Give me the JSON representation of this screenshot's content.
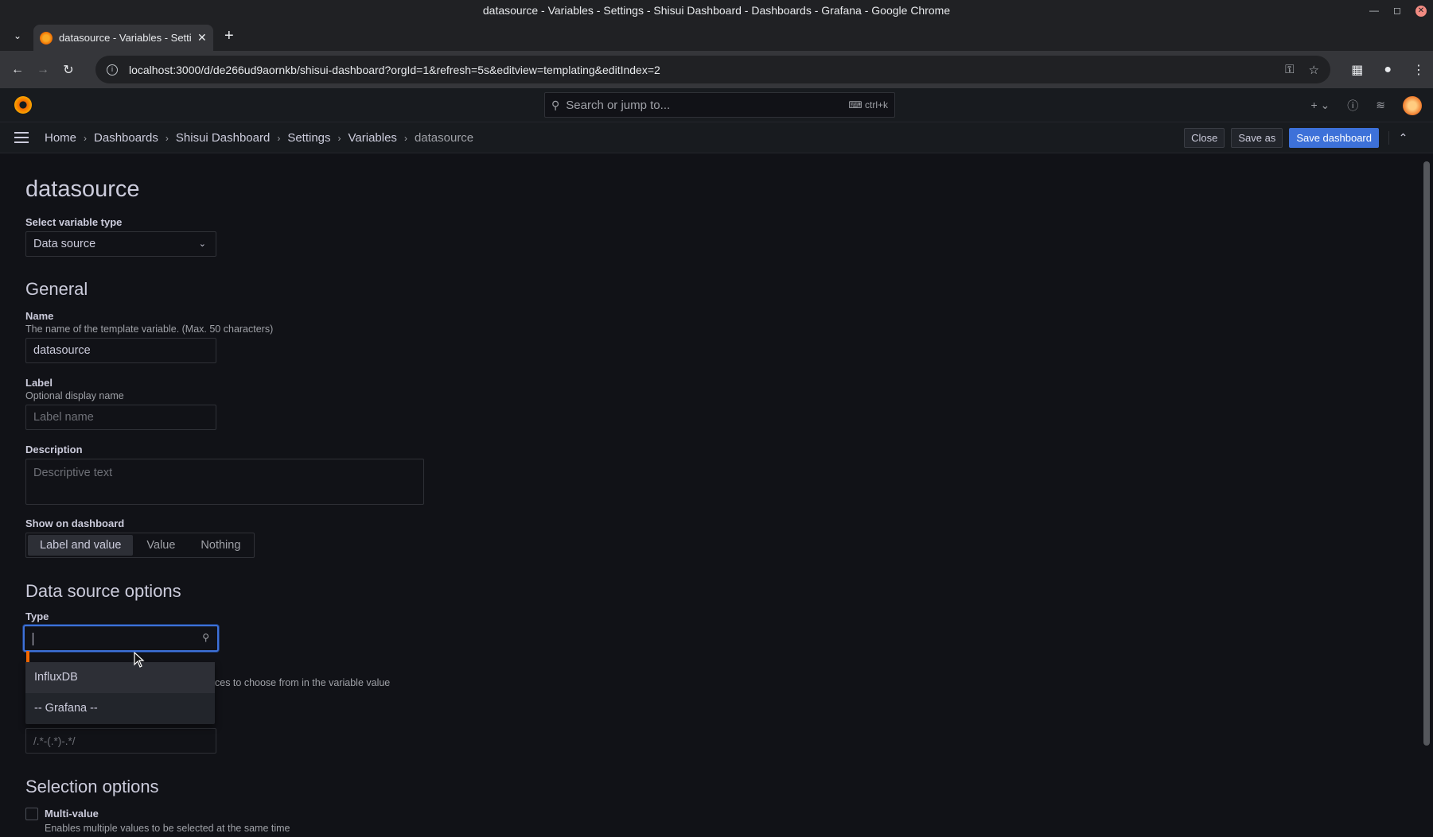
{
  "window": {
    "title": "datasource - Variables - Settings - Shisui Dashboard - Dashboards - Grafana - Google Chrome"
  },
  "browser": {
    "tab_title": "datasource - Variables - Settings - Shisui Dashboard - Dashboards - Grafana",
    "url": "localhost:3000/d/de266ud9aornkb/shisui-dashboard?orgId=1&refresh=5s&editview=templating&editIndex=2"
  },
  "grafana": {
    "search_placeholder": "Search or jump to...",
    "search_shortcut": "ctrl+k",
    "breadcrumbs": [
      "Home",
      "Dashboards",
      "Shisui Dashboard",
      "Settings",
      "Variables",
      "datasource"
    ],
    "buttons": {
      "close": "Close",
      "save_as": "Save as",
      "save_dashboard": "Save dashboard"
    }
  },
  "form": {
    "title": "datasource",
    "variable_type_label": "Select variable type",
    "variable_type_value": "Data source",
    "general_heading": "General",
    "name_label": "Name",
    "name_desc": "The name of the template variable. (Max. 50 characters)",
    "name_value": "datasource",
    "label_label": "Label",
    "label_desc": "Optional display name",
    "label_placeholder": "Label name",
    "description_label": "Description",
    "description_placeholder": "Descriptive text",
    "show_on_dashboard_label": "Show on dashboard",
    "show_options": [
      "Label and value",
      "Value",
      "Nothing"
    ],
    "show_selected": "Label and value",
    "ds_options_heading": "Data source options",
    "type_label": "Type",
    "type_options": [
      "InfluxDB",
      "-- Grafana --"
    ],
    "instance_desc_visible": "ces to choose from in the variable value",
    "regex_placeholder": "/.*-(.*)-.*/",
    "selection_heading": "Selection options",
    "multi_value_label": "Multi-value",
    "multi_value_desc": "Enables multiple values to be selected at the same time"
  },
  "colors": {
    "accent": "#3d71d9",
    "background": "#111217",
    "loading": "#f46800"
  }
}
